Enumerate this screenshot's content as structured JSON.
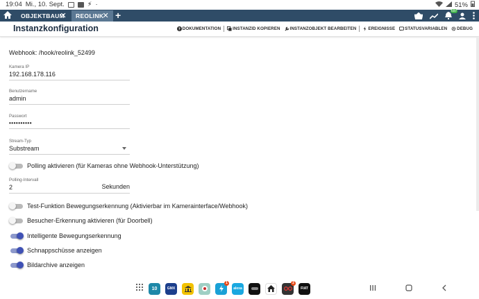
{
  "statusbar": {
    "time": "19:04",
    "date": "Mi., 10. Sept.",
    "battery": "51%"
  },
  "tabs": [
    {
      "label": "OBJEKTBAUM",
      "close": "✕"
    },
    {
      "label": "REOLINK",
      "close": "✕"
    }
  ],
  "tabbar": {
    "add": "+",
    "badge": "697"
  },
  "header": {
    "title": "Instanzkonfiguration",
    "actions": [
      "DOKUMENTATION",
      "INSTANZID KOPIEREN",
      "INSTANZOBJEKT BEARBEITEN",
      "EREIGNISSE",
      "STATUSVARIABLEN",
      "DEBUG"
    ]
  },
  "form": {
    "webhook": "Webhook: /hook/reolink_52499",
    "ip_label": "Kamera IP",
    "ip_value": "192.168.178.116",
    "user_label": "Benutzername",
    "user_value": "admin",
    "pass_label": "Passwort",
    "pass_value": "••••••••••",
    "stream_label": "Stream-Typ",
    "stream_value": "Substream",
    "polling_label": "Polling aktivieren (für Kameras ohne Webhook-Unterstützung)",
    "interval_label": "Polling-Intervall",
    "interval_value": "2",
    "interval_unit": "Sekunden",
    "test_label": "Test-Funktion Bewegungserkennung (Aktivierbar im Kamerainterface/Webhook)",
    "visitor_label": "Besucher-Erkennung aktivieren (für Doorbell)",
    "smart_label": "Intelligente Bewegungserkennung",
    "snap_label": "Schnappschüsse anzeigen",
    "archive_label": "Bildarchive anzeigen",
    "polling_on": false,
    "test_on": false,
    "visitor_on": false,
    "smart_on": true,
    "snap_on": true,
    "archive_on": true
  },
  "dock": {
    "calendar": "10",
    "gmx": "GMX",
    "alexa": "alexa",
    "fiat": "FIAT",
    "badge_a": "1",
    "badge_b": "2"
  },
  "colors": {
    "tabbar": "#2f4c67",
    "active_tab": "#5b7893",
    "switch_on": "#3f51b5"
  }
}
